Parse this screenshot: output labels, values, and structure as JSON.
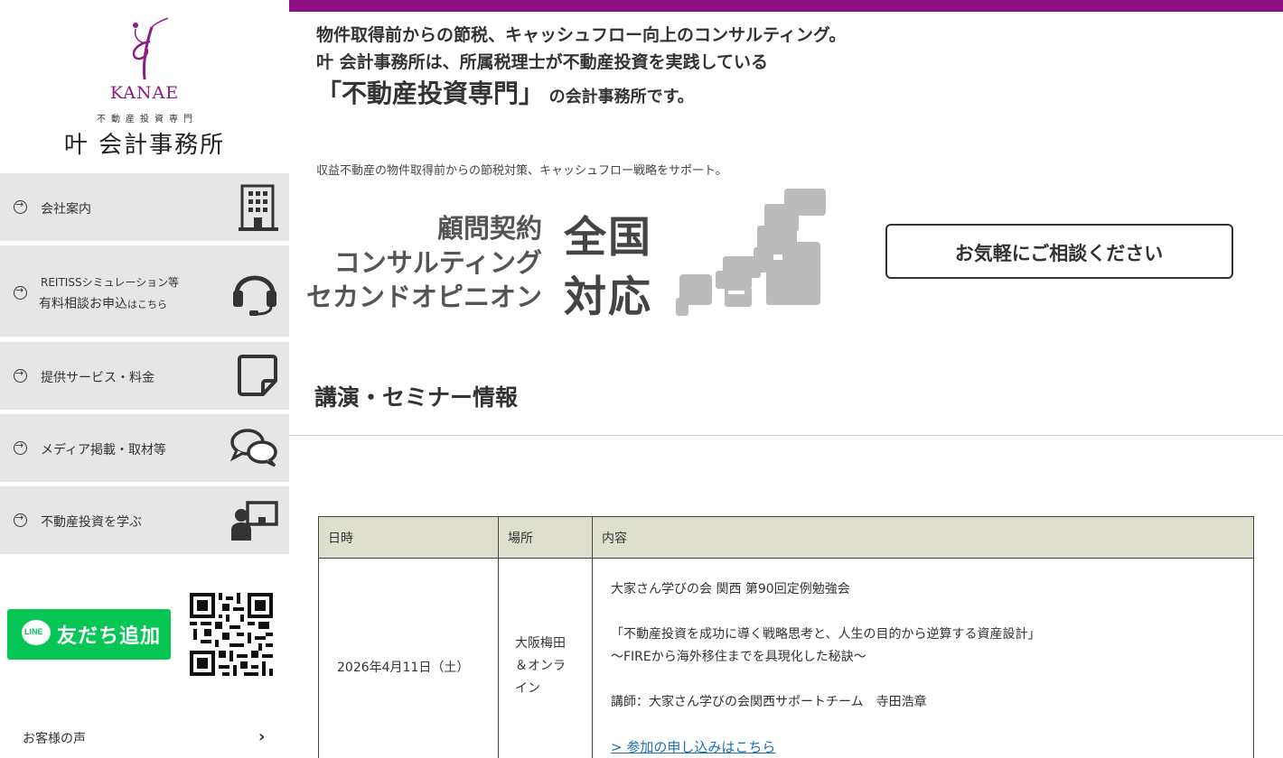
{
  "sidebar": {
    "brand": "KANAE",
    "sub_title": "不動産投資専門",
    "office_name": "叶 会計事務所",
    "nav": [
      {
        "label": "会社案内",
        "icon": "building-icon"
      },
      {
        "label_top": "REITISSシミュレーション等",
        "label_main": "有料相談お申込",
        "label_suffix": "はこちら",
        "icon": "headset-icon"
      },
      {
        "label": "提供サービス・料金",
        "icon": "note-icon"
      },
      {
        "label": "メディア掲載・取材等",
        "icon": "chat-bubbles-icon"
      },
      {
        "label": "不動産投資を学ぶ",
        "icon": "presenter-icon"
      }
    ],
    "line_button": {
      "logo_text": "LINE",
      "label": "友だち追加"
    },
    "voice_link": "お客様の声"
  },
  "hero": {
    "line1": "物件取得前からの節税、キャッシュフロー向上のコンサルティング。",
    "line2": "叶 会計事務所は、所属税理士が不動産投資を実践している",
    "highlight": "「不動産投資専門」",
    "line3_rest": "の会計事務所です。",
    "sub_text": "収益不動産の物件取得前からの節税対策、キャッシュフロー戦略をサポート。"
  },
  "banner": {
    "lines": [
      "顧問契約",
      "コンサルティング",
      "セカンドオピニオン"
    ],
    "big1": "全国",
    "big2": "対応"
  },
  "contact_button": "お気軽にご相談ください",
  "seminar": {
    "title": "講演・セミナー情報",
    "headers": [
      "日時",
      "場所",
      "内容"
    ],
    "rows": [
      {
        "date": "2026年4月11日（土）",
        "place": "大阪梅田＆オンライン",
        "event": "大家さん学びの会 関西 第90回定例勉強会",
        "topic1": "「不動産投資を成功に導く戦略思考と、人生の目的から逆算する資産設計」",
        "topic2": "〜FIREから海外移住までを具現化した秘訣〜",
        "speaker": "講師：大家さん学びの会関西サポートチーム　寺田浩章",
        "link": "> 参加の申し込みはこちら"
      }
    ]
  },
  "colors": {
    "accent": "#8e0f86",
    "nav_bg": "#e6e6e6",
    "line_green": "#06c755",
    "table_header_bg": "#dfdfd0",
    "link": "#1a6fb5"
  }
}
